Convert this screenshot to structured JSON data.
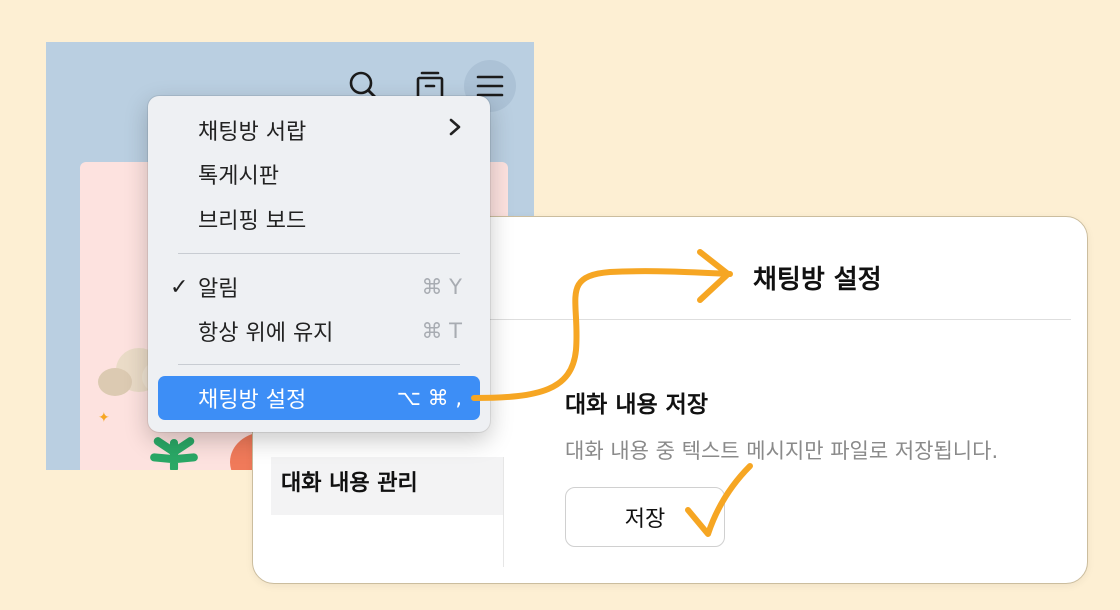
{
  "toolbar": {
    "icons": [
      "search-icon",
      "archive-icon",
      "menu-icon"
    ]
  },
  "menu": {
    "items": [
      {
        "label": "채팅방 서랍",
        "has_submenu": true
      },
      {
        "label": "톡게시판"
      },
      {
        "label": "브리핑 보드"
      },
      {
        "label": "알림",
        "checked": true,
        "check": "✓",
        "shortcut": "⌘ Y"
      },
      {
        "label": "항상 위에 유지",
        "shortcut": "⌘ T"
      },
      {
        "label": "채팅방 설정",
        "shortcut": "⌥ ⌘ ,",
        "selected": true
      }
    ],
    "submenu_glyph": "›"
  },
  "settings": {
    "title": "채팅방 설정",
    "sidebar_item": "대화 내용 관리",
    "section_title": "대화 내용 저장",
    "section_desc": "대화 내용 중 텍스트 메시지만 파일로 저장됩니다.",
    "save_button": "저장"
  },
  "colors": {
    "background": "#fdefd3",
    "accent_orange": "#f6a623",
    "menu_highlight": "#3d8ef6",
    "chat_bg": "#bacfe1"
  }
}
